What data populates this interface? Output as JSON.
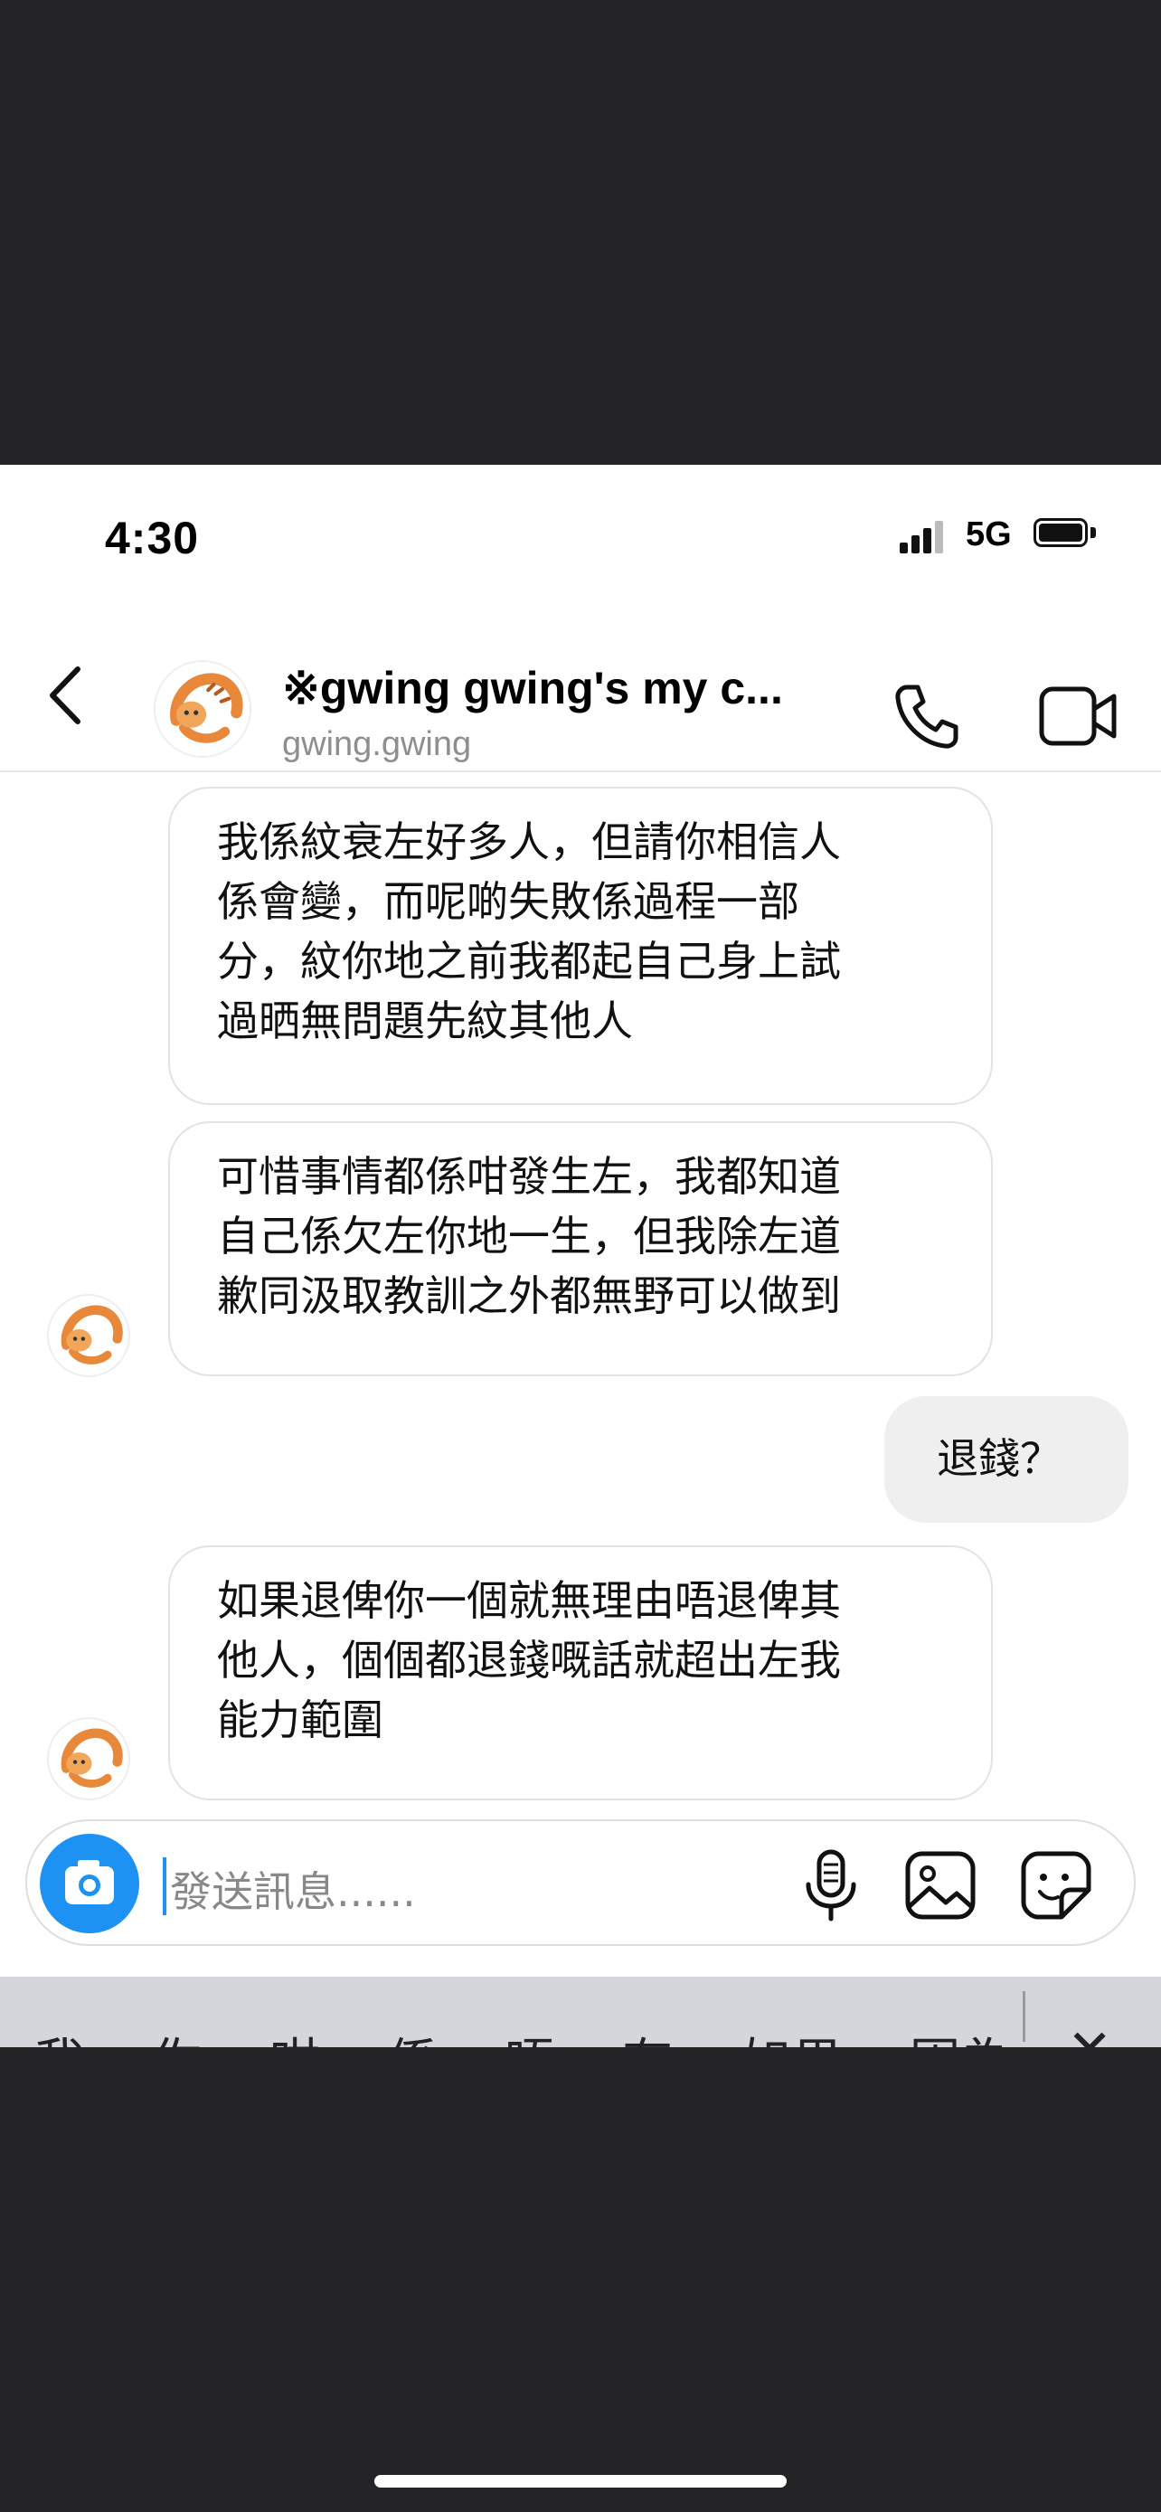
{
  "status_bar": {
    "time": "4:30",
    "network": "5G"
  },
  "header": {
    "title": "※gwing gwing's my c...",
    "username": "gwing.gwing"
  },
  "messages": [
    {
      "sender": "them",
      "text": "我係紋衰左好多人，但請你相信人\n係會變，而呢啲失敗係過程一部\n分，紋你地之前我都起自己身上試\n過晒無問題先紋其他人"
    },
    {
      "sender": "them",
      "text": "可惜事情都係咁發生左，我都知道\n自己係欠左你地一生，但我除左道\n歉同汲取教訓之外都無野可以做到"
    },
    {
      "sender": "me",
      "text": "退錢？"
    },
    {
      "sender": "them",
      "text": "如果退俾你一個就無理由唔退俾其\n他人，個個都退錢嘅話就超出左我\n能力範圍"
    }
  ],
  "composer": {
    "placeholder": "發送訊息......"
  },
  "keyboard_suggestions": [
    "我",
    "你",
    "咁",
    "係",
    "唔",
    "有",
    "如果",
    "因為"
  ],
  "colors": {
    "accent": "#1d92f2",
    "their_bubble_border": "#e3e3e3",
    "my_bubble": "#efefef"
  }
}
